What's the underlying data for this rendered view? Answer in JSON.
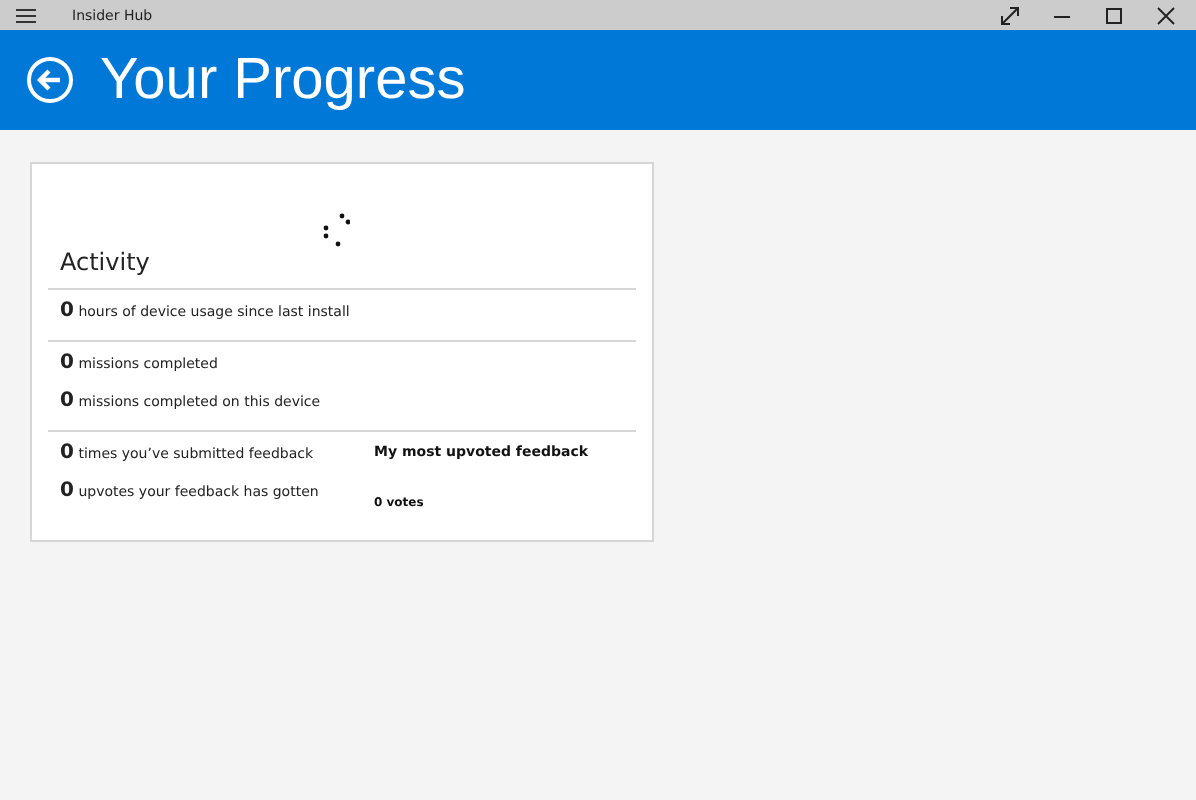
{
  "window": {
    "title": "Insider Hub"
  },
  "header": {
    "title": "Your Progress"
  },
  "activity": {
    "title": "Activity",
    "sections": [
      {
        "stats": [
          {
            "value": "0",
            "label": "hours of device usage since last install"
          }
        ]
      },
      {
        "stats": [
          {
            "value": "0",
            "label": "missions completed"
          },
          {
            "value": "0",
            "label": "missions completed on this device"
          }
        ]
      },
      {
        "stats": [
          {
            "value": "0",
            "label": "times you’ve submitted feedback"
          },
          {
            "value": "0",
            "label": "upvotes your feedback has gotten"
          }
        ],
        "feedback": {
          "title": "My most upvoted feedback",
          "votes": "0 votes"
        }
      }
    ]
  }
}
